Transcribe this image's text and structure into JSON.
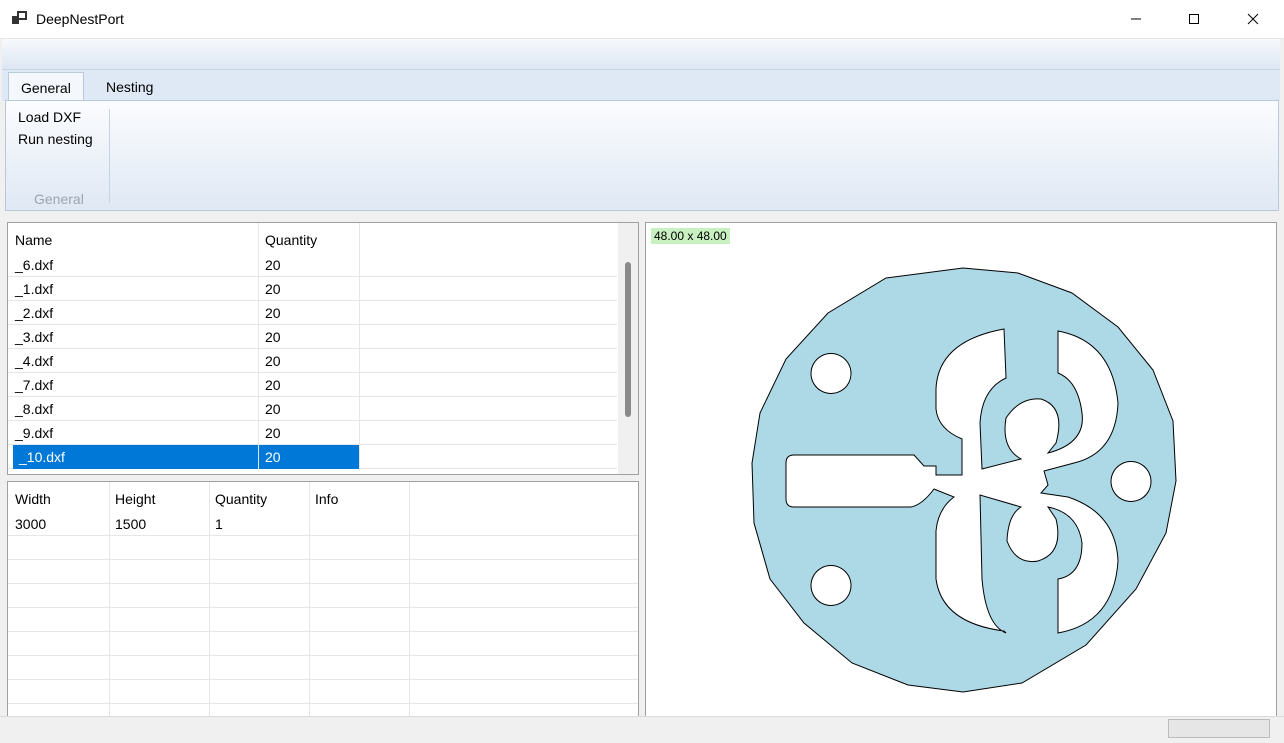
{
  "window": {
    "title": "DeepNestPort"
  },
  "ribbon": {
    "tabs": [
      {
        "label": "General"
      },
      {
        "label": "Nesting"
      }
    ],
    "commands": [
      {
        "label": "Load DXF"
      },
      {
        "label": "Run nesting"
      }
    ],
    "group_label": "General"
  },
  "parts_grid": {
    "headers": [
      "Name",
      "Quantity"
    ],
    "rows": [
      {
        "name": "_6.dxf",
        "quantity": "20"
      },
      {
        "name": "_1.dxf",
        "quantity": "20"
      },
      {
        "name": "_2.dxf",
        "quantity": "20"
      },
      {
        "name": "_3.dxf",
        "quantity": "20"
      },
      {
        "name": "_4.dxf",
        "quantity": "20"
      },
      {
        "name": "_7.dxf",
        "quantity": "20"
      },
      {
        "name": "_8.dxf",
        "quantity": "20"
      },
      {
        "name": "_9.dxf",
        "quantity": "20"
      },
      {
        "name": "_10.dxf",
        "quantity": "20"
      }
    ],
    "selected_row": "_10.dxf"
  },
  "sheets_grid": {
    "headers": [
      "Width",
      "Height",
      "Quantity",
      "Info"
    ],
    "rows": [
      {
        "width": "3000",
        "height": "1500",
        "quantity": "1",
        "info": ""
      }
    ]
  },
  "preview": {
    "size_label": "48.00 x 48.00",
    "fill_color": "#add8e6",
    "outline_color": "#000000"
  },
  "colors": {
    "selection": "#0078d7",
    "ribbon": "#dfe9f5"
  }
}
